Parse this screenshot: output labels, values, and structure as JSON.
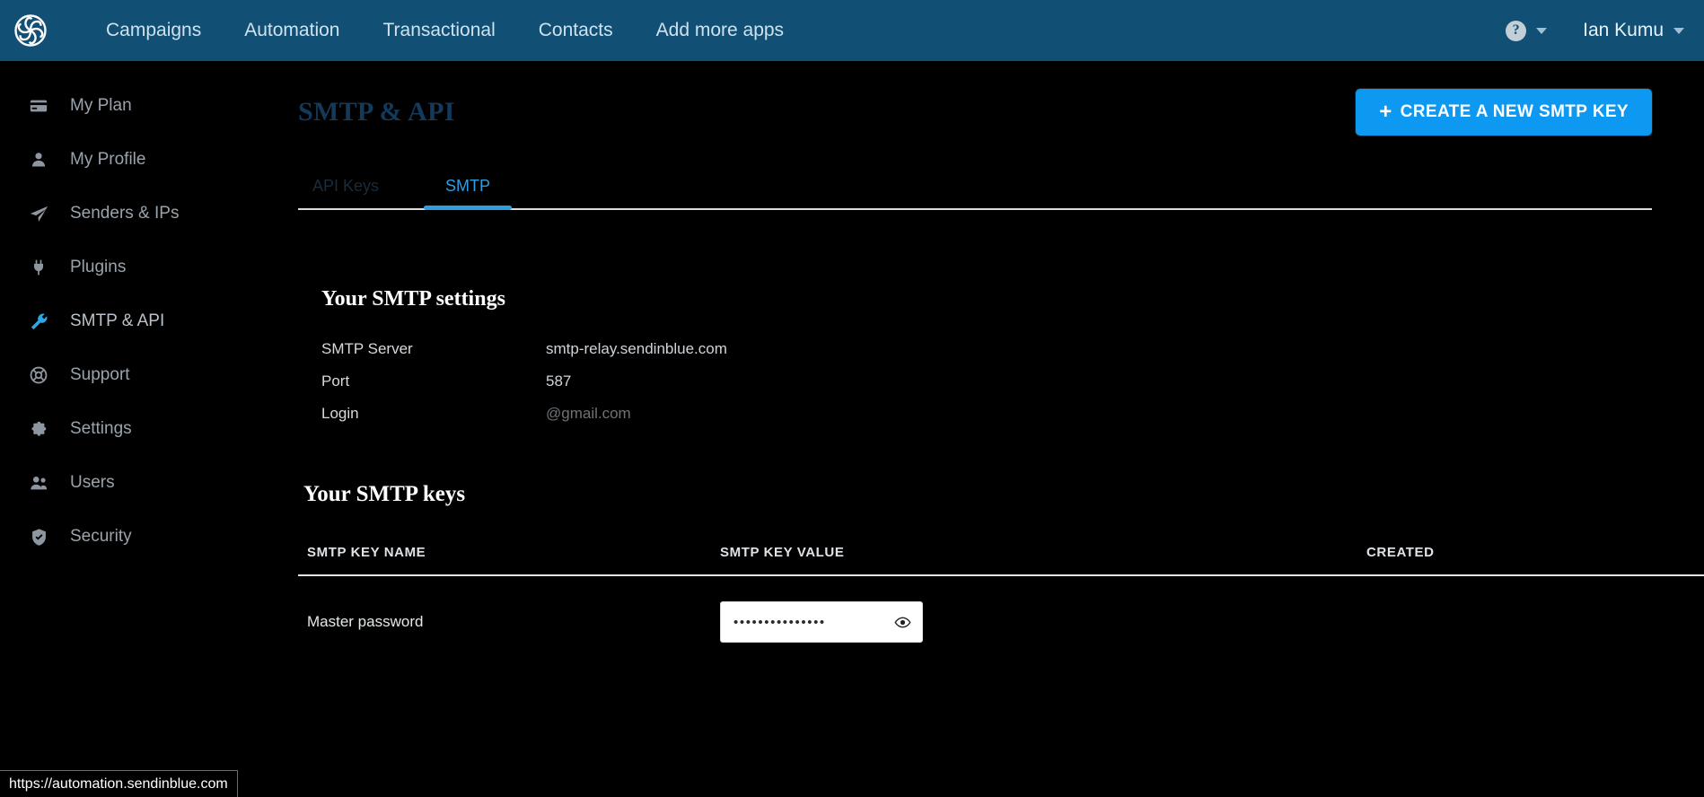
{
  "topbar": {
    "logo_icon": "sendinblue-pinwheel-logo",
    "nav_items": [
      {
        "label": "Campaigns"
      },
      {
        "label": "Automation"
      },
      {
        "label": "Transactional"
      },
      {
        "label": "Contacts"
      },
      {
        "label": "Add more apps"
      }
    ],
    "help_glyph": "?",
    "user_name": "Ian Kumu"
  },
  "sidebar": {
    "items": [
      {
        "label": "My Plan",
        "icon": "credit-card-icon"
      },
      {
        "label": "My Profile",
        "icon": "user-icon"
      },
      {
        "label": "Senders & IPs",
        "icon": "paper-plane-icon"
      },
      {
        "label": "Plugins",
        "icon": "plug-icon"
      },
      {
        "label": "SMTP & API",
        "icon": "wrench-icon"
      },
      {
        "label": "Support",
        "icon": "lifebuoy-icon"
      },
      {
        "label": "Settings",
        "icon": "gear-icon"
      },
      {
        "label": "Users",
        "icon": "users-icon"
      },
      {
        "label": "Security",
        "icon": "shield-check-icon"
      }
    ]
  },
  "page": {
    "title": "SMTP & API",
    "create_button": "CREATE A NEW SMTP KEY",
    "create_button_plus": "+",
    "tabs": [
      {
        "label": "API Keys"
      },
      {
        "label": "SMTP"
      }
    ]
  },
  "smtp_settings": {
    "title": "Your SMTP settings",
    "rows": [
      {
        "label": "SMTP Server",
        "value": "smtp-relay.sendinblue.com",
        "redacted": false
      },
      {
        "label": "Port",
        "value": "587",
        "redacted": false
      },
      {
        "label": "Login",
        "value": "@gmail.com",
        "redacted": true
      }
    ]
  },
  "smtp_keys": {
    "title": "Your SMTP keys",
    "columns": {
      "name": "SMTP KEY NAME",
      "value": "SMTP KEY VALUE",
      "created": "CREATED"
    },
    "rows": [
      {
        "name": "Master password",
        "value_masked": "•••••••••••••••",
        "created": ""
      }
    ]
  },
  "status_bar": {
    "url": "https://automation.sendinblue.com"
  },
  "colors": {
    "topbar_blue": "#114f74",
    "accent_blue": "#0d99f2",
    "tab_active_blue": "#2f9ee0",
    "title_navy": "#13395b",
    "page_background": "#000000"
  }
}
